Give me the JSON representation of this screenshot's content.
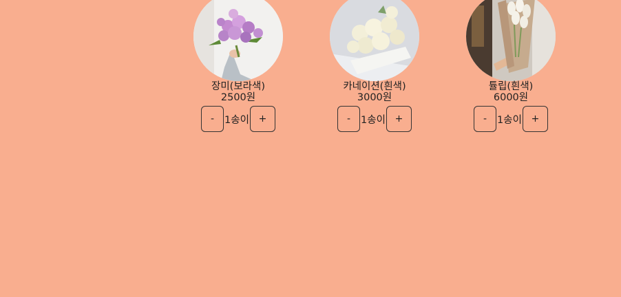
{
  "products": [
    {
      "name": "장미(보라색)",
      "price": "2500원",
      "quantity": "1송이",
      "minus_label": "-",
      "plus_label": "+",
      "image": "purple-rose-bouquet"
    },
    {
      "name": "카네이션(흰색)",
      "price": "3000원",
      "quantity": "1송이",
      "minus_label": "-",
      "plus_label": "+",
      "image": "white-carnation-bouquet"
    },
    {
      "name": "튤립(흰색)",
      "price": "6000원",
      "quantity": "1송이",
      "minus_label": "-",
      "plus_label": "+",
      "image": "white-tulip-bouquet"
    }
  ],
  "colors": {
    "background": "#f9ae8f"
  }
}
